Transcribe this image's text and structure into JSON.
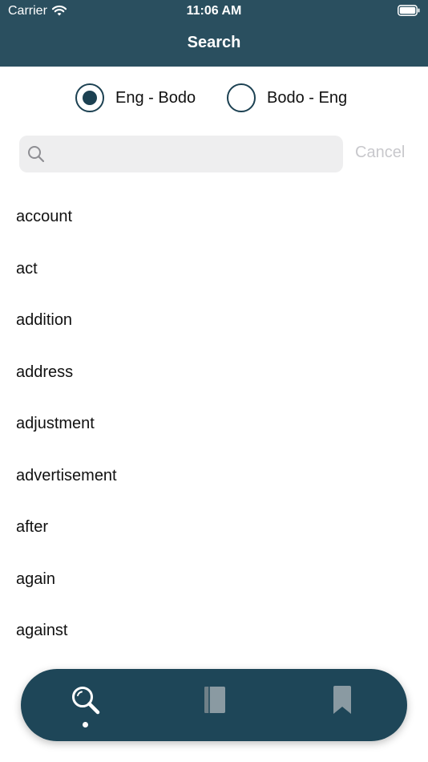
{
  "status_bar": {
    "carrier": "Carrier",
    "time": "11:06 AM"
  },
  "nav": {
    "title": "Search"
  },
  "language_toggle": {
    "options": [
      {
        "label": "Eng - Bodo",
        "selected": true
      },
      {
        "label": "Bodo - Eng",
        "selected": false
      }
    ]
  },
  "search": {
    "placeholder": "",
    "value": "",
    "cancel_label": "Cancel"
  },
  "words": [
    "account",
    "act",
    "addition",
    "address",
    "adjustment",
    "advertisement",
    "after",
    "again",
    "against"
  ],
  "tab_bar": {
    "tabs": [
      {
        "icon": "search-icon",
        "active": true
      },
      {
        "icon": "book-icon",
        "active": false
      },
      {
        "icon": "bookmark-icon",
        "active": false
      }
    ]
  },
  "colors": {
    "header": "#2a4f5f",
    "accent": "#1c4152",
    "tab_bar": "#1e4658"
  }
}
